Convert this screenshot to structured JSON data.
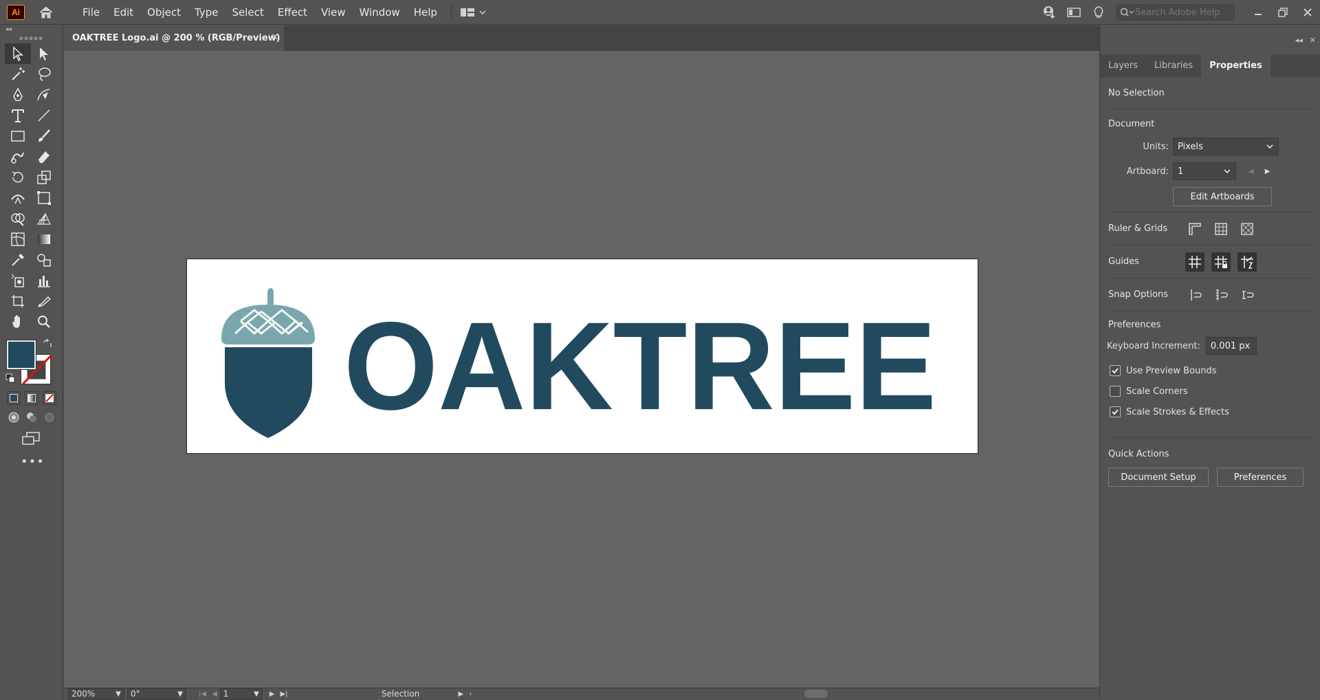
{
  "app": {
    "logo_text": "Ai",
    "menu": [
      "File",
      "Edit",
      "Object",
      "Type",
      "Select",
      "Effect",
      "View",
      "Window",
      "Help"
    ],
    "search_placeholder": "Search Adobe Help"
  },
  "document": {
    "tab_title": "OAKTREE Logo.ai @ 200 % (RGB/Preview)",
    "close_glyph": "✕"
  },
  "artwork": {
    "logo_text": "OAKTREE",
    "brand_color": "#224a5e",
    "cap_color": "#7aa7ad"
  },
  "statusbar": {
    "zoom": "200%",
    "rotation": "0°",
    "artboard_number": "1",
    "current_tool": "Selection"
  },
  "panel": {
    "tabs": [
      "Layers",
      "Libraries",
      "Properties"
    ],
    "active_tab": "Properties",
    "selection_state": "No Selection",
    "document": {
      "title": "Document",
      "units_label": "Units:",
      "units_value": "Pixels",
      "artboard_label": "Artboard:",
      "artboard_value": "1",
      "edit_artboards": "Edit Artboards"
    },
    "ruler_grids": "Ruler & Grids",
    "guides": "Guides",
    "snap_options": "Snap Options",
    "preferences": {
      "title": "Preferences",
      "keyboard_increment_label": "Keyboard Increment:",
      "keyboard_increment_value": "0.001 px",
      "checkboxes": [
        {
          "label": "Use Preview Bounds",
          "checked": true
        },
        {
          "label": "Scale Corners",
          "checked": false
        },
        {
          "label": "Scale Strokes & Effects",
          "checked": true
        }
      ]
    },
    "quick_actions": {
      "title": "Quick Actions",
      "document_setup": "Document Setup",
      "preferences": "Preferences"
    }
  },
  "colors": {
    "fill": "#224a5e",
    "stroke": "none"
  }
}
